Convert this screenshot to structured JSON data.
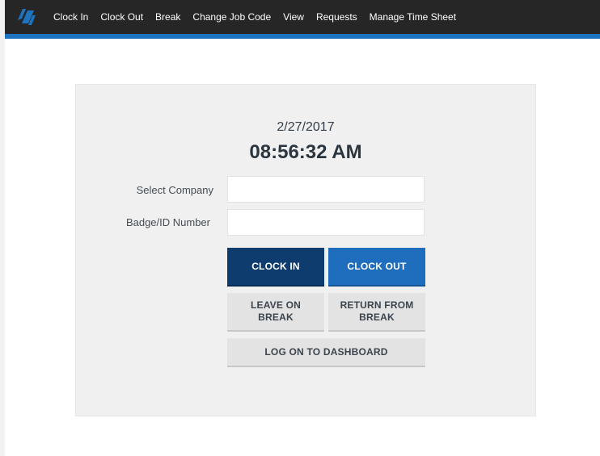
{
  "navbar": {
    "logo": "brand-logo",
    "items": [
      {
        "label": "Clock In"
      },
      {
        "label": "Clock Out"
      },
      {
        "label": "Break"
      },
      {
        "label": "Change Job Code"
      },
      {
        "label": "View"
      },
      {
        "label": "Requests"
      },
      {
        "label": "Manage Time Sheet"
      }
    ]
  },
  "clock": {
    "date": "2/27/2017",
    "time": "08:56:32 AM"
  },
  "form": {
    "company_label": "Select Company",
    "company_value": "",
    "badge_label": "Badge/ID Number",
    "badge_value": ""
  },
  "buttons": {
    "clock_in": "CLOCK IN",
    "clock_out": "CLOCK OUT",
    "leave_break": "LEAVE ON\nBREAK",
    "return_break": "RETURN FROM\nBREAK",
    "dashboard": "LOG ON TO DASHBOARD"
  },
  "colors": {
    "nav_bg": "#262626",
    "nav_accent": "#1e73be",
    "clock_in_bg": "#0e3c6f",
    "clock_out_bg": "#1f6dbd",
    "secondary_bg": "#e3e3e3"
  }
}
